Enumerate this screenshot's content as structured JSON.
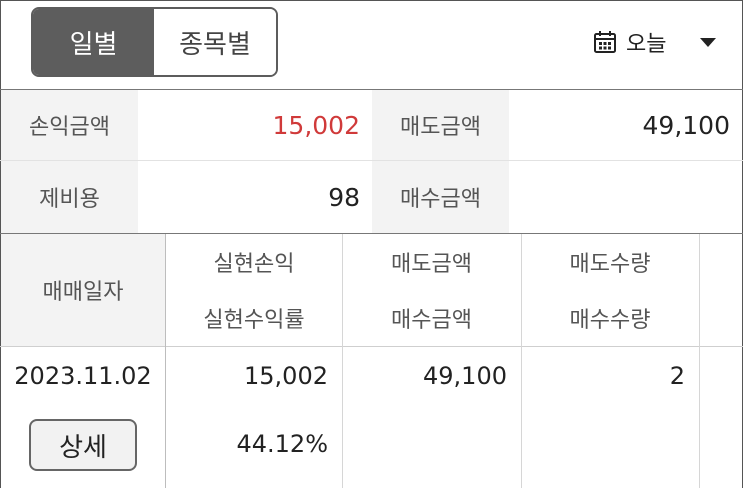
{
  "tabs": {
    "daily": "일별",
    "by_stock": "종목별"
  },
  "date_select": {
    "label": "오늘",
    "icon": "calendar-icon"
  },
  "summary": {
    "pnl_label": "손익금액",
    "pnl_value": "15,002",
    "sell_amount_label": "매도금액",
    "sell_amount_value": "49,100",
    "fees_label": "제비용",
    "fees_value": "98",
    "buy_amount_label": "매수금액",
    "buy_amount_value": ""
  },
  "table": {
    "headers": {
      "trade_date": "매매일자",
      "realized_pnl": "실현손익",
      "realized_return": "실현수익률",
      "sell_amount": "매도금액",
      "buy_amount": "매수금액",
      "sell_qty": "매도수량",
      "buy_qty": "매수수량"
    },
    "rows": [
      {
        "trade_date": "2023.11.02",
        "realized_pnl": "15,002",
        "realized_return": "44.12%",
        "sell_amount": "49,100",
        "sell_qty": "2",
        "detail_button": "상세"
      }
    ]
  },
  "colors": {
    "profit": "#d03a3a",
    "tab_active_bg": "#5d5d5d",
    "label_bg": "#f3f3f3"
  }
}
